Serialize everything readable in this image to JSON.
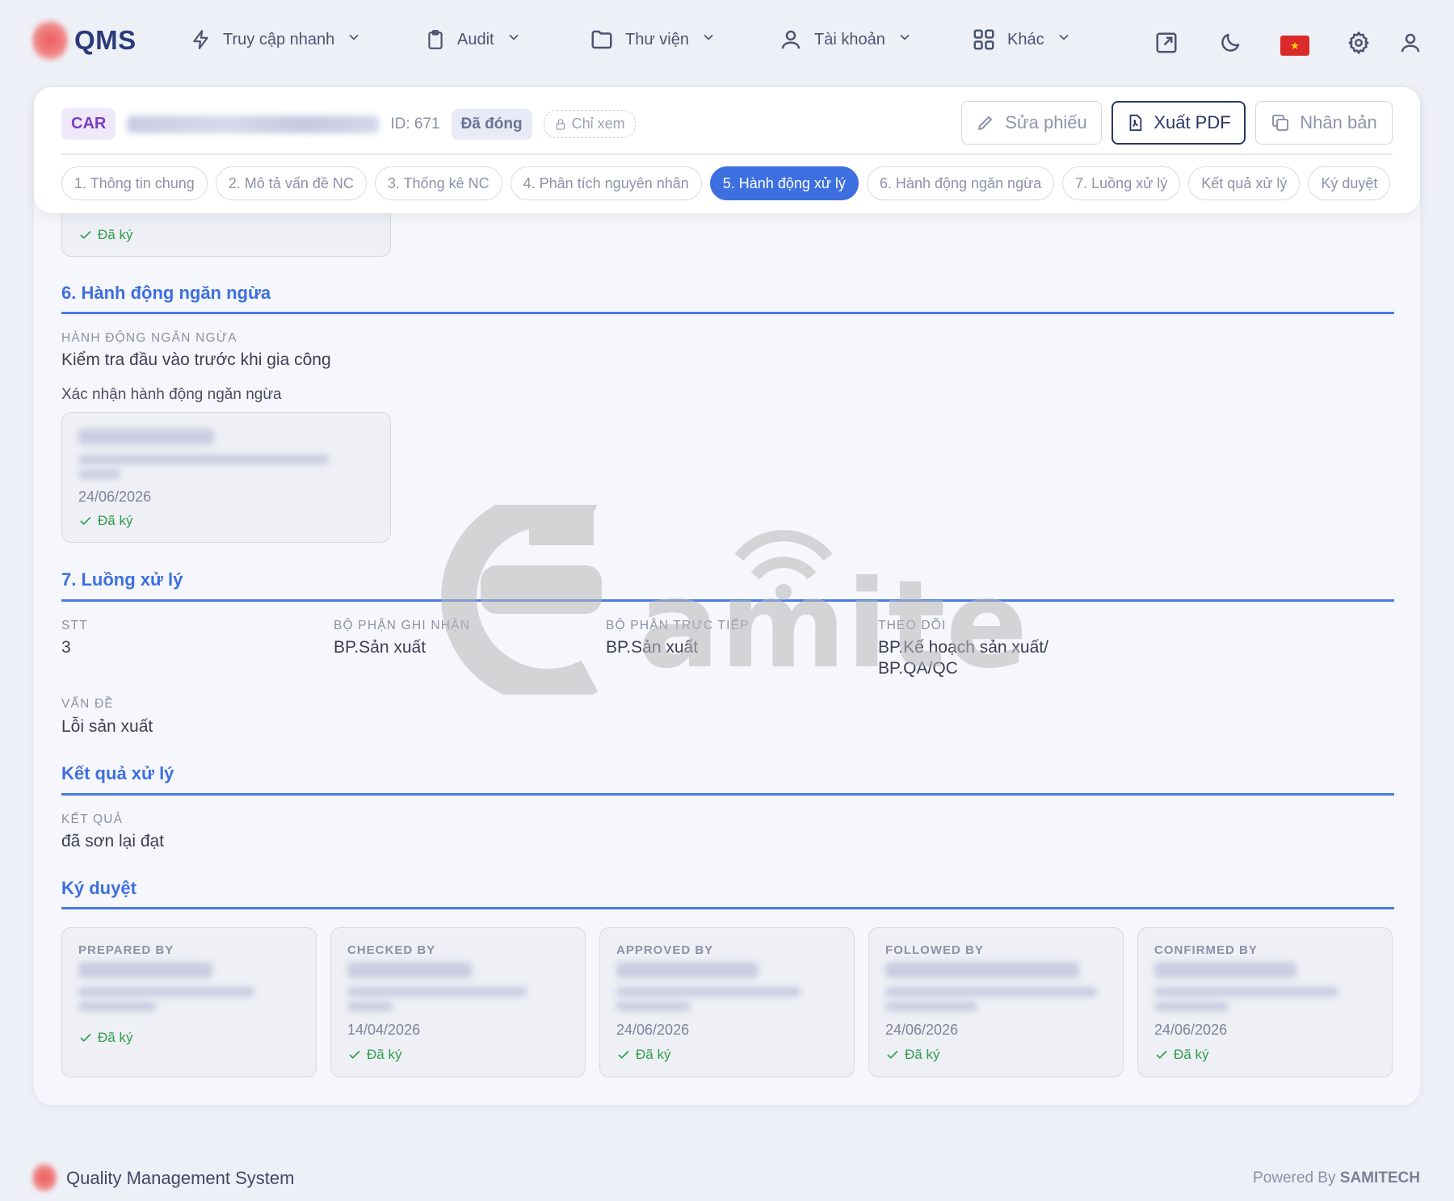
{
  "brand": {
    "name": "QMS"
  },
  "nav": {
    "items": [
      {
        "label": "Truy cập nhanh",
        "icon": "lightning-icon"
      },
      {
        "label": "Audit",
        "icon": "clipboard-icon"
      },
      {
        "label": "Thư viện",
        "icon": "folder-icon"
      },
      {
        "label": "Tài khoản",
        "icon": "user-icon"
      },
      {
        "label": "Khác",
        "icon": "grid-icon"
      }
    ],
    "right_icons": [
      "expand-icon",
      "moon-icon",
      "vn-flag-icon",
      "gear-icon",
      "profile-icon"
    ]
  },
  "header": {
    "type_tag": "CAR",
    "id_text": "ID: 671",
    "status": "Đã đóng",
    "view_mode": "Chỉ xem",
    "buttons": {
      "edit": "Sửa phiếu",
      "export": "Xuất PDF",
      "duplicate": "Nhân bản"
    }
  },
  "tabs": [
    {
      "label": "1. Thông tin chung",
      "active": false
    },
    {
      "label": "2. Mô tả vấn đề NC",
      "active": false
    },
    {
      "label": "3. Thống kê NC",
      "active": false
    },
    {
      "label": "4. Phân tích nguyên nhân",
      "active": false
    },
    {
      "label": "5. Hành động xử lý",
      "active": true
    },
    {
      "label": "6. Hành động ngăn ngừa",
      "active": false
    },
    {
      "label": "7. Luồng xử lý",
      "active": false
    },
    {
      "label": "Kết quả xử lý",
      "active": false
    },
    {
      "label": "Ký duyệt",
      "active": false
    }
  ],
  "top_sig": {
    "signed": "Đã ký"
  },
  "preventive": {
    "title": "6. Hành động ngăn ngừa",
    "label": "HÀNH ĐỘNG NGĂN NGỪA",
    "value": "Kiểm tra đầu vào trước khi gia công",
    "confirm_label": "Xác nhận hành động ngăn ngừa",
    "sig": {
      "date": "24/06/2026",
      "signed": "Đã ký"
    }
  },
  "flow": {
    "title": "7. Luồng xử lý",
    "stt_label": "STT",
    "stt_value": "3",
    "recorder_label": "BỘ PHẬN GHI NHẬN",
    "recorder_value": "BP.Sản xuất",
    "direct_label": "BỘ PHẬN TRỰC TIẾP",
    "direct_value": "BP.Sản xuất",
    "follow_label": "THEO DÕI",
    "follow_value_1": "BP.Kế hoạch sản xuất/",
    "follow_value_2": "BP.QA/QC",
    "issue_label": "VẤN ĐỀ",
    "issue_value": "Lỗi sản xuất"
  },
  "result": {
    "title": "Kết quả xử lý",
    "label": "KẾT QUẢ",
    "value": "đã sơn lại đạt"
  },
  "approval": {
    "title": "Ký duyệt",
    "cards": [
      {
        "role": "PREPARED BY",
        "date": "",
        "signed": "Đã ký"
      },
      {
        "role": "CHECKED BY",
        "date": "14/04/2026",
        "signed": "Đã ký"
      },
      {
        "role": "APPROVED BY",
        "date": "24/06/2026",
        "signed": "Đã ký"
      },
      {
        "role": "FOLLOWED BY",
        "date": "24/06/2026",
        "signed": "Đã ký"
      },
      {
        "role": "CONFIRMED BY",
        "date": "24/06/2026",
        "signed": "Đã ký"
      }
    ]
  },
  "footer": {
    "title": "Quality Management System",
    "powered_prefix": "Powered By",
    "powered_brand": "SAMITECH"
  },
  "colors": {
    "accent": "#3d6fe0",
    "success": "#2f9d4a",
    "brand_text": "#2b3a7a",
    "car_tag": "#7a3ec4"
  }
}
